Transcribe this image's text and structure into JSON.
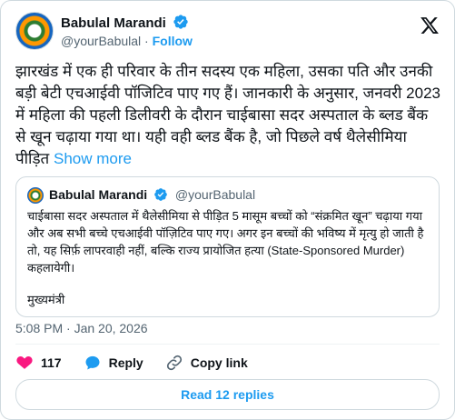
{
  "author": {
    "name": "Babulal Marandi",
    "handle": "@yourBabulal",
    "separator": "·",
    "follow_label": "Follow"
  },
  "tweet": {
    "text": "झारखंड में एक ही परिवार के तीन सदस्य एक महिला, उसका पति और उनकी बड़ी बेटी  एचआईवी पॉजिटिव पाए गए हैं। जानकारी के अनुसार, जनवरी 2023 में महिला की पहली डिलीवरी के दौरान चाईबासा सदर अस्पताल के ब्लड बैंक से खून चढ़ाया गया था। यही वही ब्लड बैंक है, जो पिछले वर्ष थैलेसीमिया पीड़ित",
    "show_more": "Show more"
  },
  "quote": {
    "name": "Babulal Marandi",
    "handle": "@yourBabulal",
    "text": "चाईबासा सदर अस्पताल में थैलेसीमिया से पीड़ित 5 मासूम बच्चों को “संक्रमित खून” चढ़ाया गया और अब सभी बच्चे एचआईवी पॉज़िटिव पाए गए। अगर इन बच्चों की भविष्य में मृत्यु हो जाती है तो, यह सिर्फ़ लापरवाही नहीं, बल्कि राज्य प्रायोजित हत्या (State-Sponsored Murder) कहलायेगी।",
    "signature": "मुख्यमंत्री"
  },
  "timestamp": "5:08 PM · Jan 20, 2026",
  "actions": {
    "like_count": "117",
    "reply_label": "Reply",
    "copy_label": "Copy link"
  },
  "read_replies_label": "Read 12 replies",
  "colors": {
    "accent": "#1d9bf0",
    "like": "#f91880",
    "text": "#0f1419",
    "muted": "#536471",
    "border": "#cfd9de"
  },
  "icons": [
    "verified-badge-icon",
    "x-logo-icon",
    "heart-icon",
    "reply-icon",
    "link-icon"
  ]
}
